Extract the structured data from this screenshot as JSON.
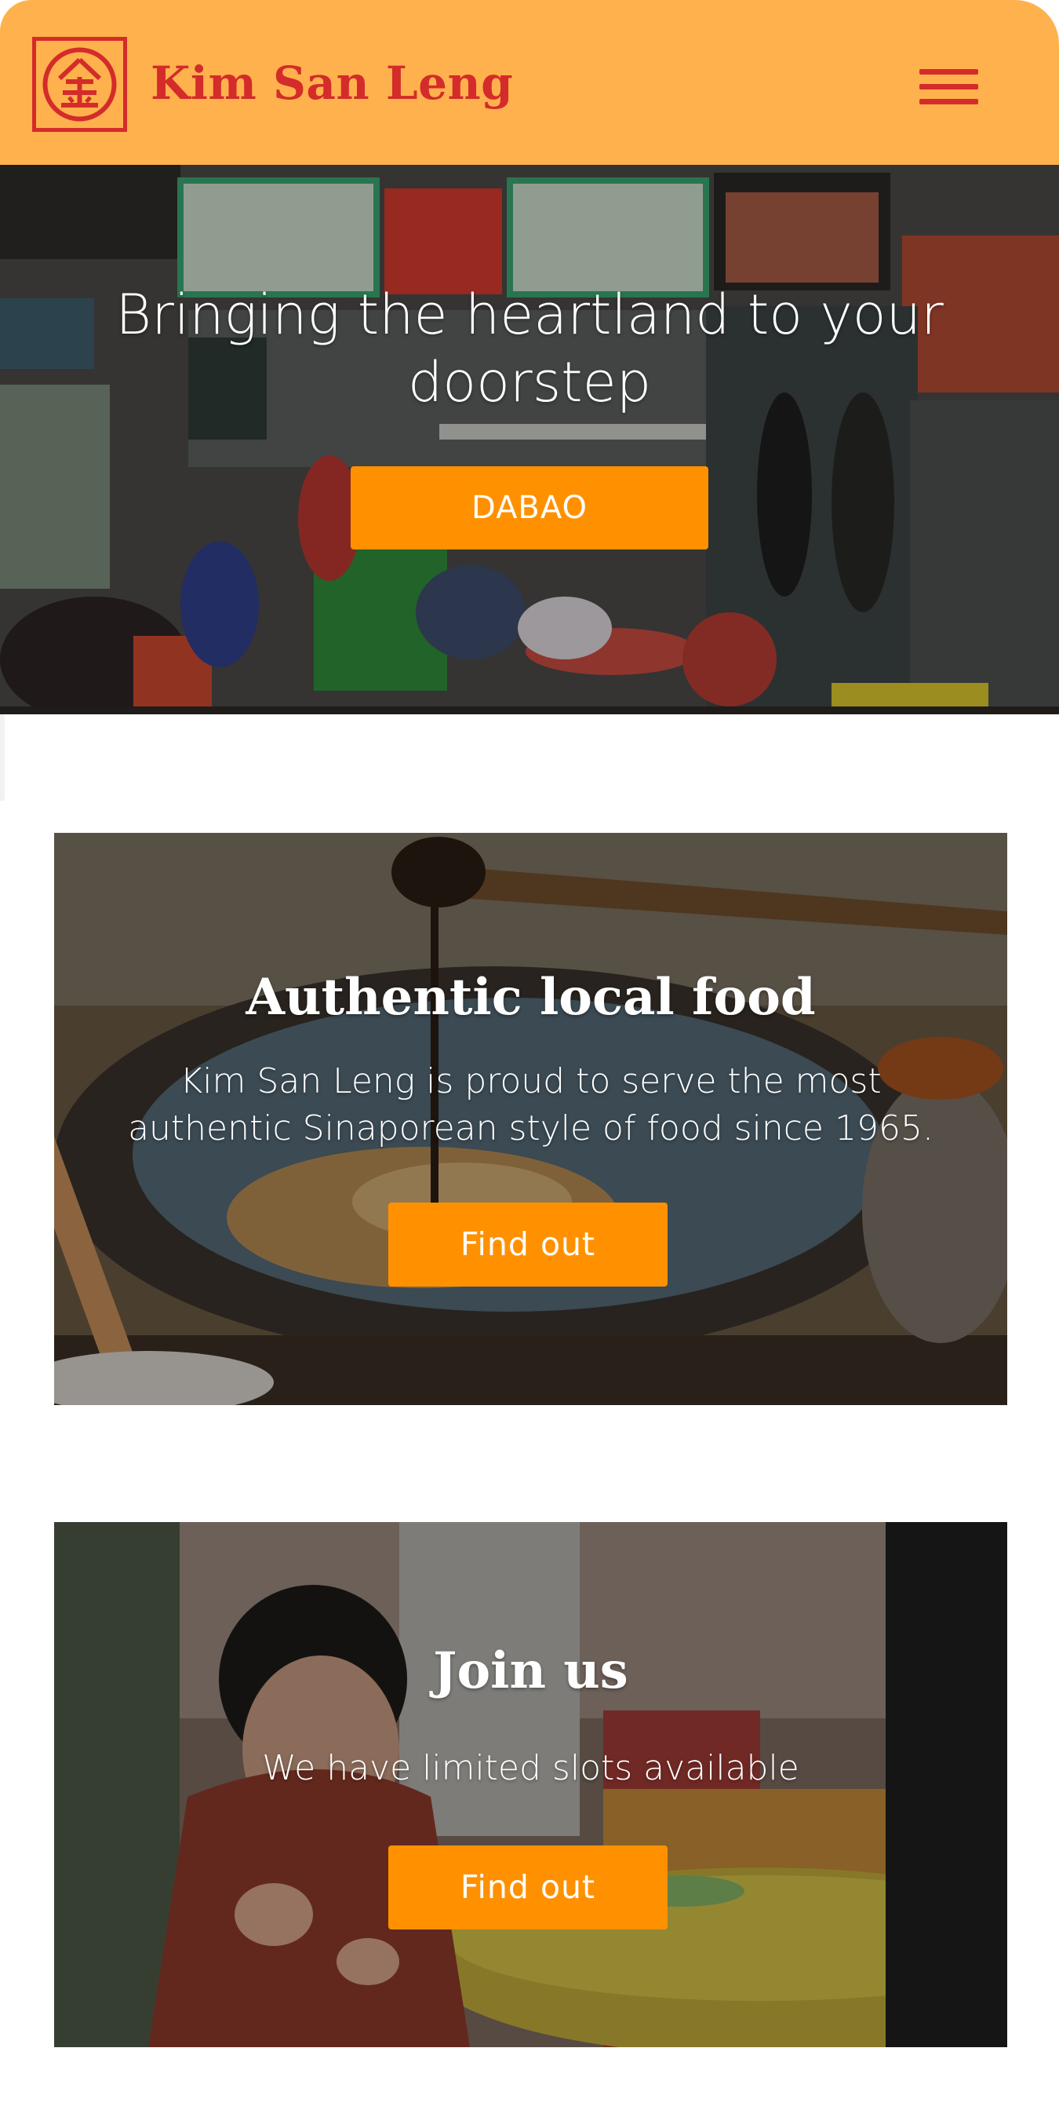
{
  "header": {
    "logo_icon": "kim-san-leng-emblem",
    "brand_name": "Kim San Leng",
    "menu_icon": "hamburger-menu-icon",
    "background_color": "#ffb14d",
    "brand_color": "#d42b2b"
  },
  "hero": {
    "title": "Bringing the heartland to your doorstep",
    "cta_label": "DABAO"
  },
  "sections": [
    {
      "title": "Authentic local food",
      "text": "Kim San Leng is proud to serve the most authentic Sinaporean style of food since 1965.",
      "cta_label": "Find out"
    },
    {
      "title": "Join us",
      "text": "We have limited slots available",
      "cta_label": "Find out"
    }
  ],
  "colors": {
    "accent": "#ff9100",
    "button_text": "#ffffff"
  }
}
